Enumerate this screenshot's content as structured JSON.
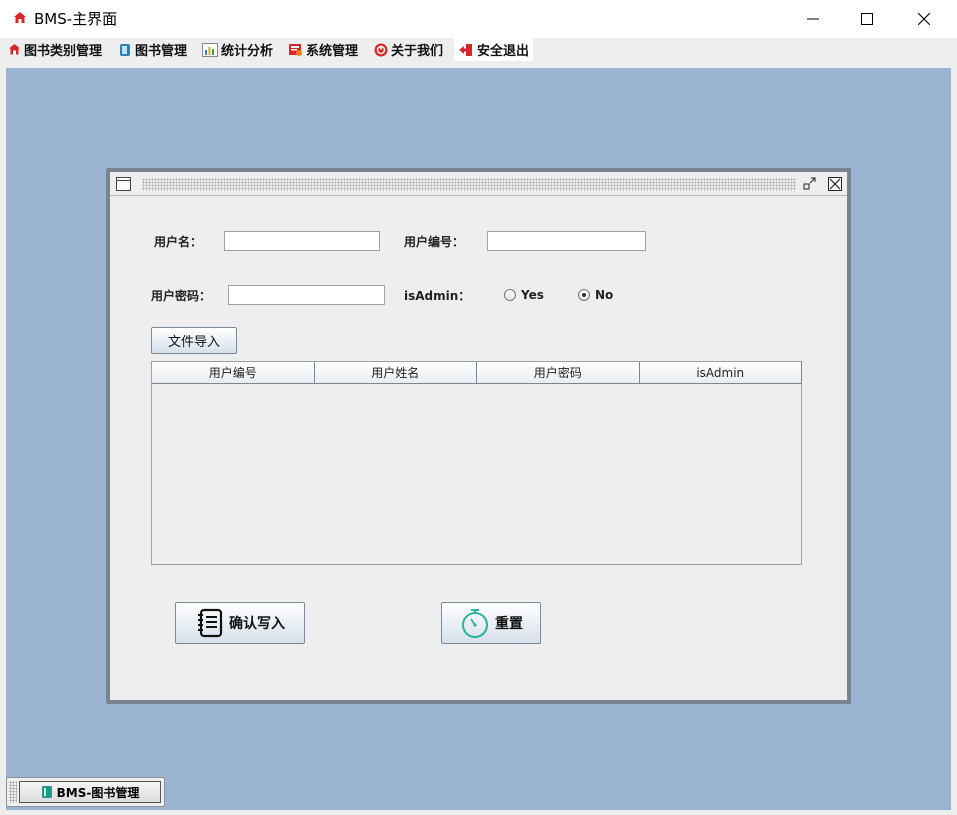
{
  "window": {
    "title": "BMS-主界面"
  },
  "menu": {
    "items": [
      {
        "label": "图书类别管理",
        "icon": "house-icon"
      },
      {
        "label": "图书管理",
        "icon": "book-icon"
      },
      {
        "label": "统计分析",
        "icon": "bar-chart-icon"
      },
      {
        "label": "系统管理",
        "icon": "settings-doc-icon"
      },
      {
        "label": "关于我们",
        "icon": "info-circle-icon"
      },
      {
        "label": "安全退出",
        "icon": "exit-icon"
      }
    ]
  },
  "form": {
    "username_label": "用户名：",
    "userid_label": "用户编号：",
    "password_label": "用户密码：",
    "isadmin_label": "isAdmin：",
    "username_value": "",
    "userid_value": "",
    "password_value": "",
    "radio_yes": "Yes",
    "radio_no": "No",
    "selected": "No",
    "import_file_button": "文件导入"
  },
  "table": {
    "columns": [
      "用户编号",
      "用户姓名",
      "用户密码",
      "isAdmin"
    ],
    "rows": []
  },
  "actions": {
    "confirm_label": "确认写入",
    "reset_label": "重置"
  },
  "iconified_frame": {
    "label": "BMS-图书管理"
  },
  "colors": {
    "desktop": "#9ab3d0",
    "frame_border": "#7a838e",
    "panel": "#eeeeee",
    "brand_red": "#d9262b"
  }
}
